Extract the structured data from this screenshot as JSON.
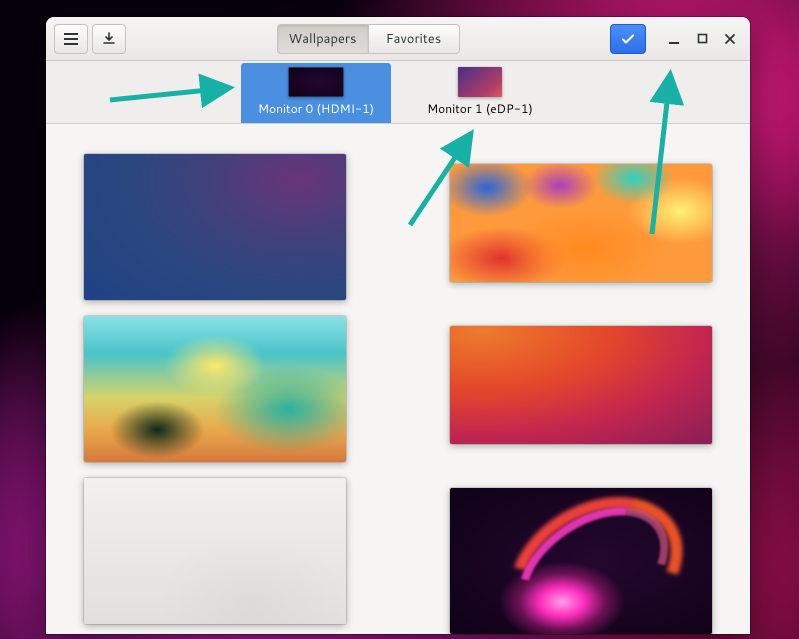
{
  "toolbar": {
    "tabs": [
      "Wallpapers",
      "Favorites"
    ],
    "active_tab": 0
  },
  "monitors": [
    {
      "label": "Monitor 0 (HDMI-1)",
      "selected": true
    },
    {
      "label": "Monitor 1 (eDP-1)",
      "selected": false
    }
  ],
  "wallpapers": {
    "left": [
      "navy-gradient",
      "abstract-painting",
      "gray-beaver"
    ],
    "right": [
      "rainbow-paint",
      "orange-beaver",
      "pink-glow-swirl"
    ]
  }
}
